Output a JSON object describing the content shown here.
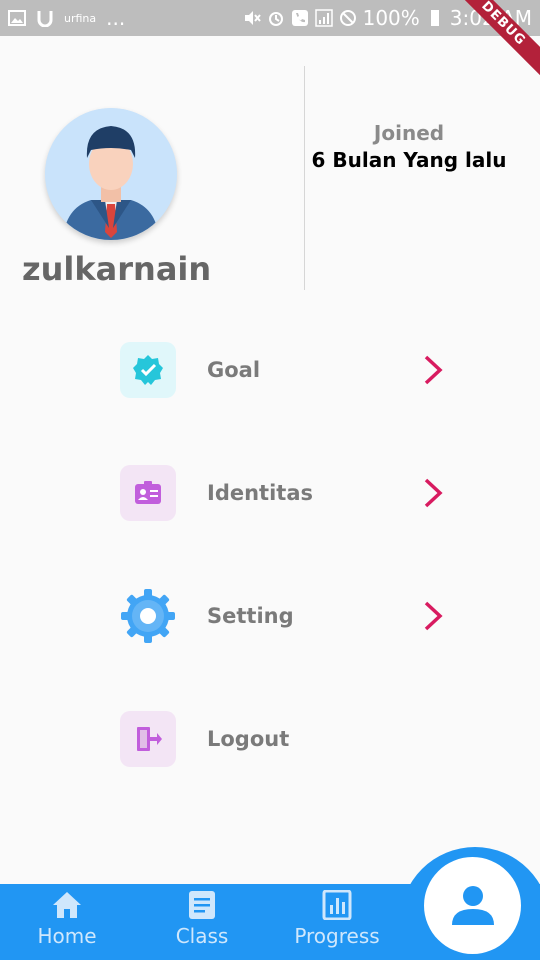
{
  "status_bar": {
    "carrier_small": "urfina",
    "dots": "...",
    "battery": "100%",
    "time": "3:02 AM",
    "debug_label": "DEBUG"
  },
  "profile": {
    "username": "zulkarnain",
    "joined_label": "Joined",
    "joined_value": "6 Bulan Yang lalu"
  },
  "menu": [
    {
      "label": "Goal",
      "icon": "goal-badge-icon",
      "chevron": true
    },
    {
      "label": "Identitas",
      "icon": "id-card-icon",
      "chevron": true
    },
    {
      "label": "Setting",
      "icon": "gear-icon",
      "chevron": true
    },
    {
      "label": "Logout",
      "icon": "logout-door-icon",
      "chevron": false
    }
  ],
  "bottom_nav": {
    "items": [
      {
        "label": "Home",
        "icon": "home-icon"
      },
      {
        "label": "Class",
        "icon": "class-icon"
      },
      {
        "label": "Progress",
        "icon": "progress-icon"
      }
    ],
    "fab_icon": "person-icon"
  },
  "colors": {
    "primary": "#2196f3",
    "chevron": "#d81b60",
    "goal_bg": "#e0f7fa",
    "identitas_bg": "#f3e5f5",
    "logout_bg": "#f3e5f5"
  }
}
